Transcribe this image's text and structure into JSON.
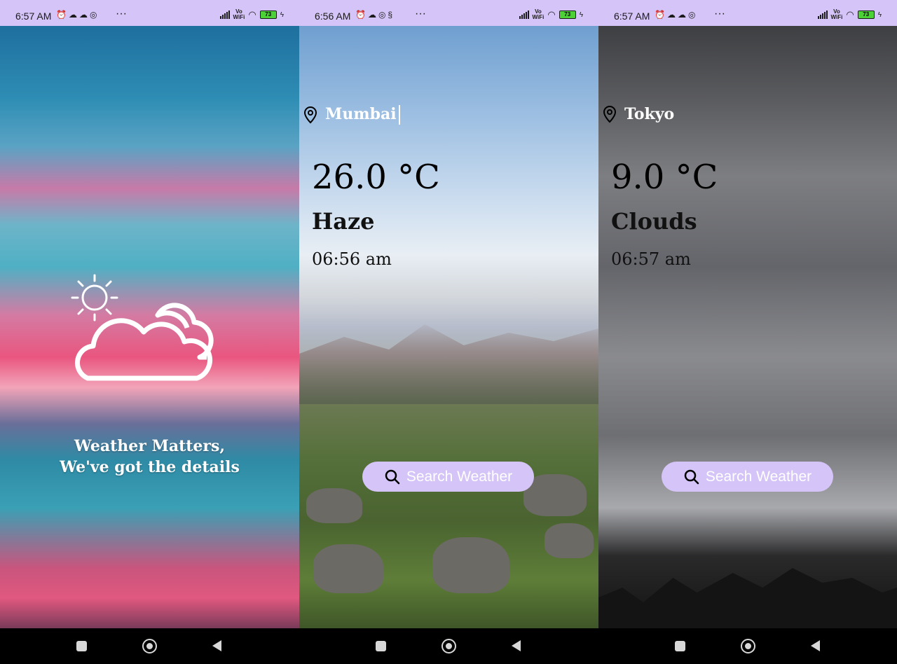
{
  "screens": [
    {
      "status": {
        "time": "6:57 AM",
        "battery": "73",
        "vowifi": "Vo\nWiFi"
      },
      "tagline_line1": "Weather Matters,",
      "tagline_line2": "We've got the details"
    },
    {
      "status": {
        "time": "6:56 AM",
        "battery": "73",
        "vowifi": "Vo\nWiFi"
      },
      "city": "Mumbai",
      "temperature": "26.0 °C",
      "condition": "Haze",
      "time": "06:56 am",
      "search_label": "Search Weather"
    },
    {
      "status": {
        "time": "6:57 AM",
        "battery": "73",
        "vowifi": "Vo\nWiFi"
      },
      "city": "Tokyo",
      "temperature": "9.0 °C",
      "condition": "Clouds",
      "time": "06:57 am",
      "search_label": "Search Weather"
    }
  ],
  "colors": {
    "accent": "#d5c4f7",
    "text_dark": "#111111",
    "text_light": "#ffffff"
  },
  "icons": [
    "location-pin-icon",
    "search-icon",
    "weather-logo-icon",
    "alarm-icon",
    "signal-icon",
    "wifi-icon",
    "battery-icon"
  ]
}
